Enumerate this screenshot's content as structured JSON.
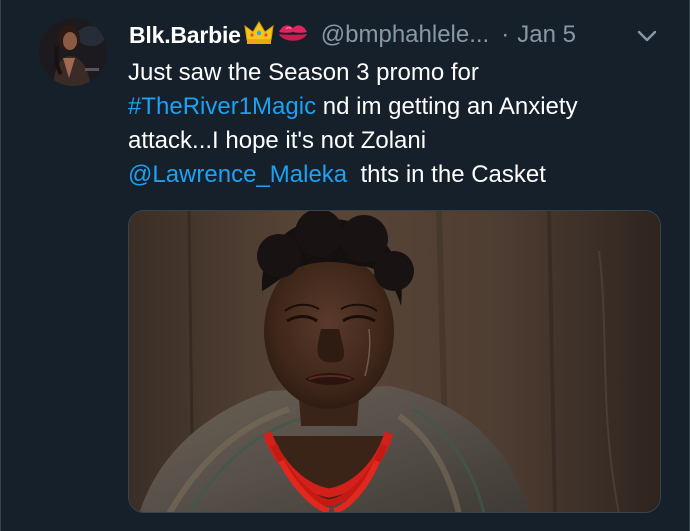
{
  "tweet": {
    "display_name": "Blk.Barbie",
    "name_emojis": [
      "crown-emoji",
      "kiss-mark-emoji"
    ],
    "handle": "@bmphahlele...",
    "separator": "·",
    "date": "Jan 5",
    "text": {
      "line1": "Just saw the Season 3 promo for",
      "hashtag": "#TheRiver1Magic",
      "line2_rest": " nd im getting an Anxiety",
      "line3": "attack...I hope it's not Zolani",
      "mention": "@Lawrence_Maleka",
      "line4_rest": "  thts in the Casket"
    },
    "media": {
      "kind": "photo"
    },
    "icons": {
      "menu": "chevron-down-icon"
    },
    "colors": {
      "background": "#15202b",
      "link": "#1da1f2",
      "secondary_text": "#8899a6",
      "primary_text": "#ffffff"
    }
  }
}
